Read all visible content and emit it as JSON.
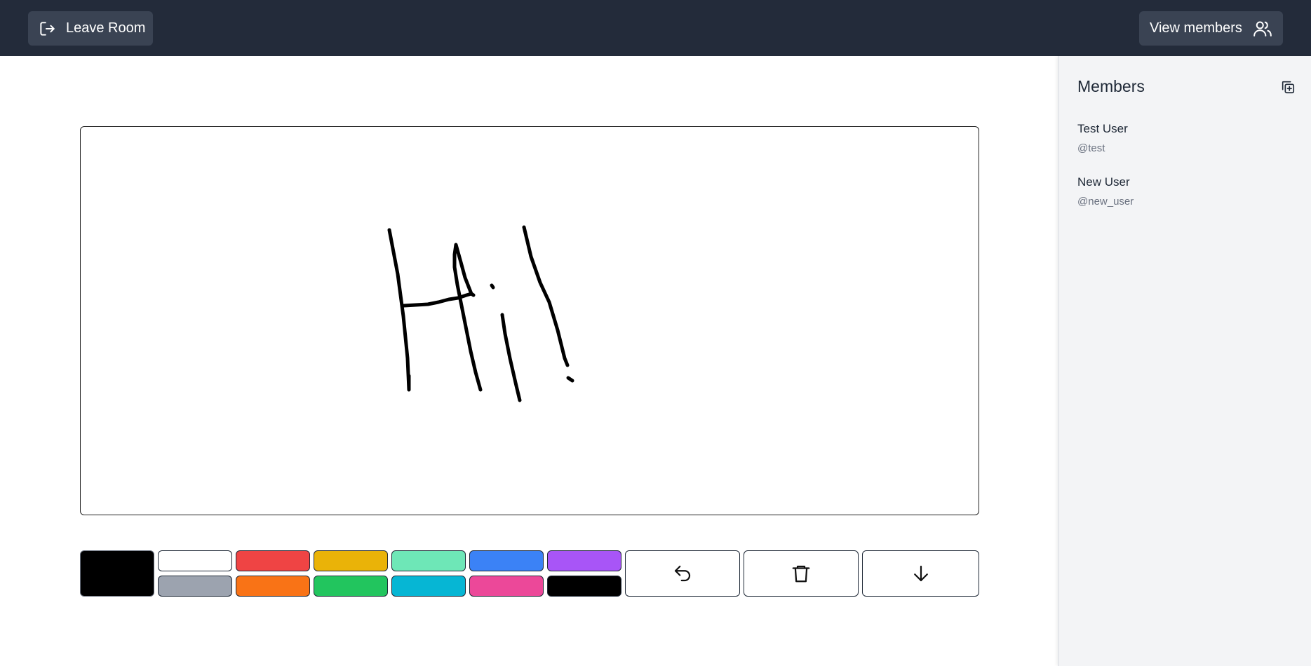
{
  "header": {
    "leave_label": "Leave Room",
    "leave_icon": "logout-icon",
    "members_label": "View members",
    "members_icon": "users-icon"
  },
  "canvas": {
    "drawing": "Hi!",
    "stroke_color": "#000000"
  },
  "palette": {
    "selected": "#000000",
    "colors": [
      {
        "name": "white",
        "hex": "#ffffff"
      },
      {
        "name": "gray",
        "hex": "#9ca3af"
      },
      {
        "name": "red",
        "hex": "#ef4444"
      },
      {
        "name": "orange",
        "hex": "#f97316"
      },
      {
        "name": "yellow",
        "hex": "#eab308"
      },
      {
        "name": "green",
        "hex": "#22c55e"
      },
      {
        "name": "mint",
        "hex": "#6ee7b7"
      },
      {
        "name": "cyan",
        "hex": "#06b6d4"
      },
      {
        "name": "blue",
        "hex": "#3b82f6"
      },
      {
        "name": "pink",
        "hex": "#ec4899"
      },
      {
        "name": "purple",
        "hex": "#a855f7"
      },
      {
        "name": "black",
        "hex": "#000000"
      }
    ]
  },
  "actions": {
    "undo_icon": "undo-icon",
    "clear_icon": "trash-icon",
    "download_icon": "arrow-down-icon"
  },
  "sidebar": {
    "title": "Members",
    "copy_icon": "copy-plus-icon",
    "members": [
      {
        "name": "Test User",
        "handle": "@test"
      },
      {
        "name": "New User",
        "handle": "@new_user"
      }
    ]
  }
}
